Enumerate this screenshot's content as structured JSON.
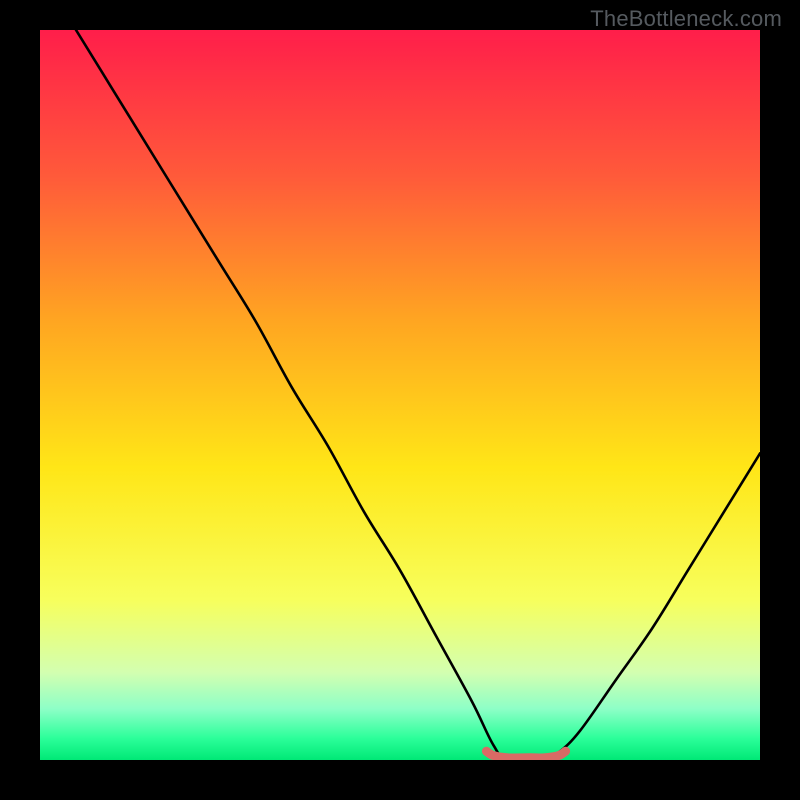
{
  "watermark": "TheBottleneck.com",
  "chart_data": {
    "type": "line",
    "title": "",
    "xlabel": "",
    "ylabel": "",
    "xlim": [
      0,
      100
    ],
    "ylim": [
      0,
      100
    ],
    "grid": false,
    "series": [
      {
        "name": "curve",
        "color": "#000000",
        "x": [
          5,
          10,
          15,
          20,
          25,
          30,
          35,
          40,
          45,
          50,
          55,
          60,
          63,
          65,
          70,
          72,
          75,
          80,
          85,
          90,
          95,
          100
        ],
        "values": [
          100,
          92,
          84,
          76,
          68,
          60,
          51,
          43,
          34,
          26,
          17,
          8,
          2,
          0,
          0,
          1,
          4,
          11,
          18,
          26,
          34,
          42
        ]
      },
      {
        "name": "flat-highlight",
        "color": "#d96a65",
        "x": [
          62,
          63,
          65,
          68,
          70,
          72,
          73
        ],
        "values": [
          1.2,
          0.6,
          0.3,
          0.3,
          0.3,
          0.6,
          1.2
        ]
      }
    ],
    "background_gradient": {
      "stops": [
        {
          "offset": 0.0,
          "color": "#ff1e4a"
        },
        {
          "offset": 0.2,
          "color": "#ff5a3a"
        },
        {
          "offset": 0.4,
          "color": "#ffa621"
        },
        {
          "offset": 0.6,
          "color": "#ffe617"
        },
        {
          "offset": 0.78,
          "color": "#f7ff5c"
        },
        {
          "offset": 0.88,
          "color": "#d3ffb0"
        },
        {
          "offset": 0.93,
          "color": "#8dffc7"
        },
        {
          "offset": 0.97,
          "color": "#2cff9a"
        },
        {
          "offset": 1.0,
          "color": "#00e876"
        }
      ]
    }
  }
}
